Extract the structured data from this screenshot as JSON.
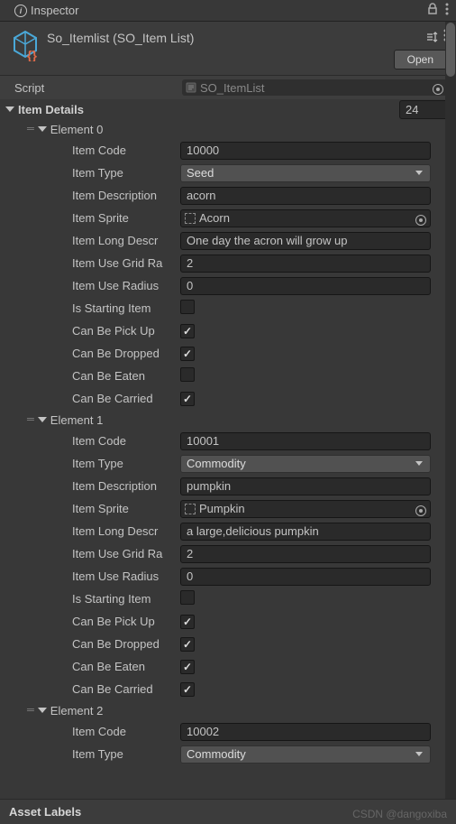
{
  "tab": {
    "title": "Inspector"
  },
  "header": {
    "title": "So_Itemlist (SO_Item List)",
    "open_label": "Open"
  },
  "script": {
    "label": "Script",
    "value": "SO_ItemList"
  },
  "item_details": {
    "label": "Item Details",
    "count": "24"
  },
  "elements": [
    {
      "name": "Element 0",
      "code_label": "Item Code",
      "code": "10000",
      "type_label": "Item Type",
      "type": "Seed",
      "desc_label": "Item Description",
      "desc": "acorn",
      "sprite_label": "Item Sprite",
      "sprite": "Acorn",
      "long_label": "Item Long Descr",
      "long": "One day the acron will grow up",
      "grid_label": "Item Use Grid Ra",
      "grid": "2",
      "radius_label": "Item Use Radius",
      "radius": "0",
      "starting_label": "Is Starting Item",
      "starting": false,
      "pickup_label": "Can Be Pick Up",
      "pickup": true,
      "dropped_label": "Can Be Dropped",
      "dropped": true,
      "eaten_label": "Can Be Eaten",
      "eaten": false,
      "carried_label": "Can Be Carried",
      "carried": true
    },
    {
      "name": "Element 1",
      "code_label": "Item Code",
      "code": "10001",
      "type_label": "Item Type",
      "type": "Commodity",
      "desc_label": "Item Description",
      "desc": "pumpkin",
      "sprite_label": "Item Sprite",
      "sprite": "Pumpkin",
      "long_label": "Item Long Descr",
      "long": "a large,delicious pumpkin",
      "grid_label": "Item Use Grid Ra",
      "grid": "2",
      "radius_label": "Item Use Radius",
      "radius": "0",
      "starting_label": "Is Starting Item",
      "starting": false,
      "pickup_label": "Can Be Pick Up",
      "pickup": true,
      "dropped_label": "Can Be Dropped",
      "dropped": true,
      "eaten_label": "Can Be Eaten",
      "eaten": true,
      "carried_label": "Can Be Carried",
      "carried": true
    },
    {
      "name": "Element 2",
      "code_label": "Item Code",
      "code": "10002",
      "type_label": "Item Type",
      "type": "Commodity"
    }
  ],
  "footer": {
    "label": "Asset Labels"
  },
  "watermark": "CSDN @dangoxiba"
}
